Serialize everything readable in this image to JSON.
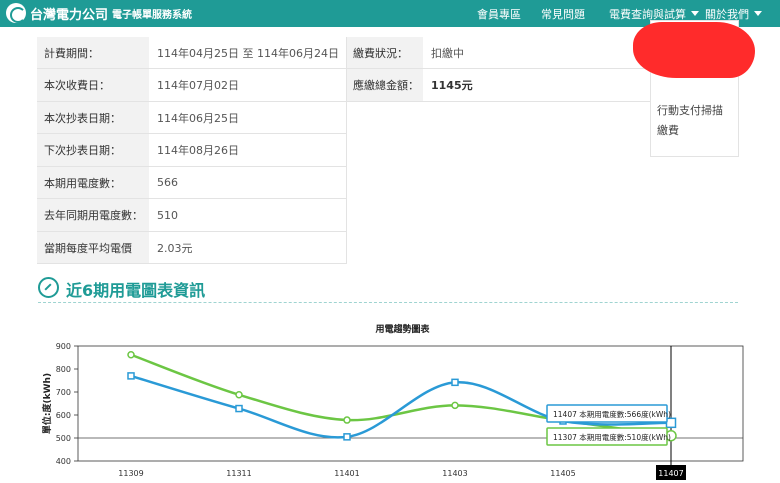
{
  "header": {
    "logo_text": "台灣電力公司",
    "logo_sub": "電子帳單服務系統",
    "nav": [
      "會員專區",
      "常見問題",
      "電費查詢與試算",
      "關於我們"
    ]
  },
  "billing": {
    "period_label": "計費期間：",
    "period_value": "114年04月25日 至 114年06月24日",
    "collect_label": "本次收費日：",
    "collect_value": "114年07月02日",
    "read_label": "本次抄表日期：",
    "read_value": "114年06月25日",
    "next_read_label": "下次抄表日期：",
    "next_read_value": "114年08月26日",
    "usage_label": "本期用電度數：",
    "usage_value": "566",
    "last_year_label": "去年同期用電度數：",
    "last_year_value": "510",
    "avg_price_label": "當期每度平均電價",
    "avg_price_value": "2.03元",
    "status_label": "繳費狀況：",
    "status_value": "扣繳中",
    "total_label": "應繳總金額：",
    "total_value": "1145元"
  },
  "side": {
    "line1": "行動支付掃描",
    "line2": "繳費"
  },
  "section": {
    "title": "近6期用電圖表資訊"
  },
  "chart_data": {
    "type": "line",
    "title": "用電趨勢圖表",
    "ylabel": "單位:度(kWh)",
    "xlabel": "",
    "categories": [
      "11309",
      "11311",
      "11401",
      "11403",
      "11405",
      "11407"
    ],
    "ylim": [
      400,
      900
    ],
    "yticks": [
      400,
      500,
      600,
      700,
      800,
      900
    ],
    "series": [
      {
        "name": "本期用電度數",
        "color": "#2a9ad6",
        "marker": "square",
        "values": [
          770,
          628,
          505,
          742,
          574,
          566
        ]
      },
      {
        "name": "去年同期用電度數",
        "color": "#6cc644",
        "marker": "circle",
        "values": [
          862,
          688,
          578,
          642,
          576,
          510
        ]
      }
    ],
    "reference_line": 500,
    "tooltip": {
      "category": "11407",
      "lines": [
        "11407 本期用電度數:566度(kWh)",
        "11307 本期用電度數:510度(kWh)"
      ]
    }
  }
}
